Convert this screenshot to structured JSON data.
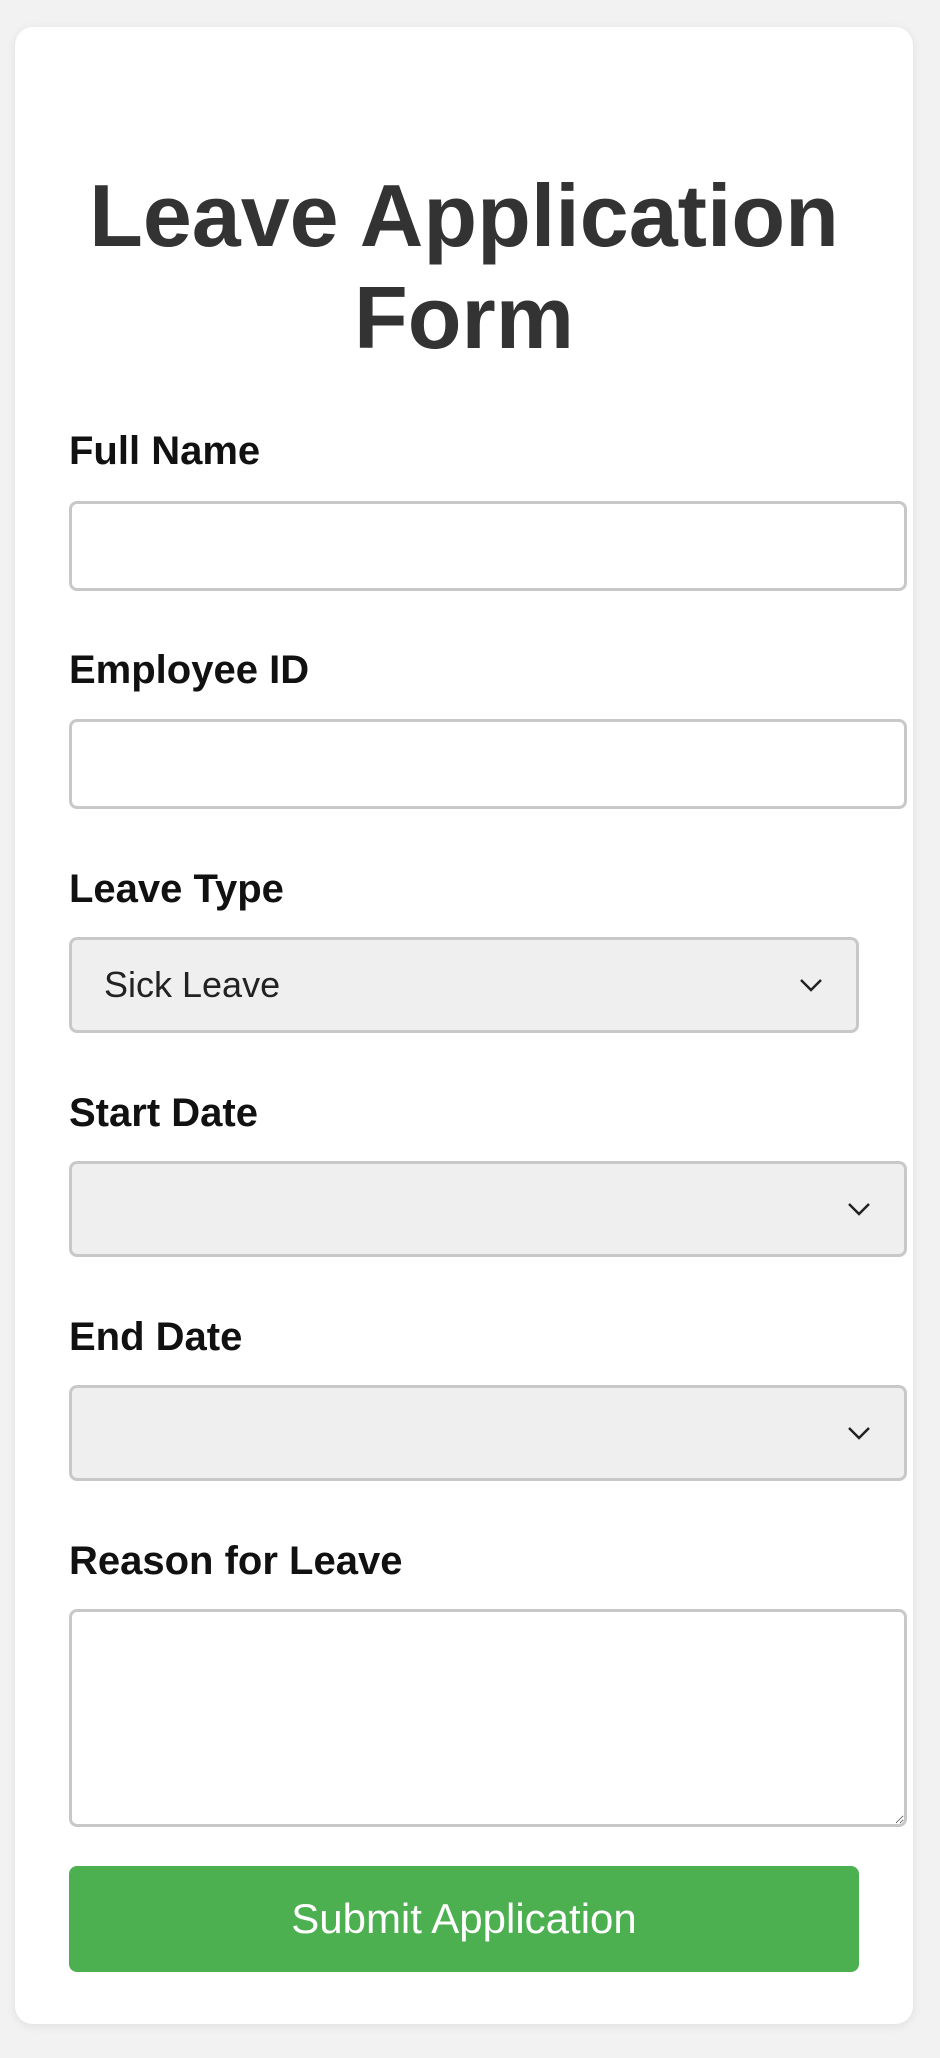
{
  "form": {
    "title": "Leave Application Form",
    "full_name": {
      "label": "Full Name",
      "value": ""
    },
    "employee_id": {
      "label": "Employee ID",
      "value": ""
    },
    "leave_type": {
      "label": "Leave Type",
      "selected": "Sick Leave"
    },
    "start_date": {
      "label": "Start Date",
      "value": ""
    },
    "end_date": {
      "label": "End Date",
      "value": ""
    },
    "reason": {
      "label": "Reason for Leave",
      "value": ""
    },
    "submit_label": "Submit Application"
  },
  "icons": {
    "select_arrow": "chevron-down-icon"
  },
  "colors": {
    "submit_bg": "#4caf50",
    "title": "#333333",
    "page_bg": "#f2f2f2"
  }
}
